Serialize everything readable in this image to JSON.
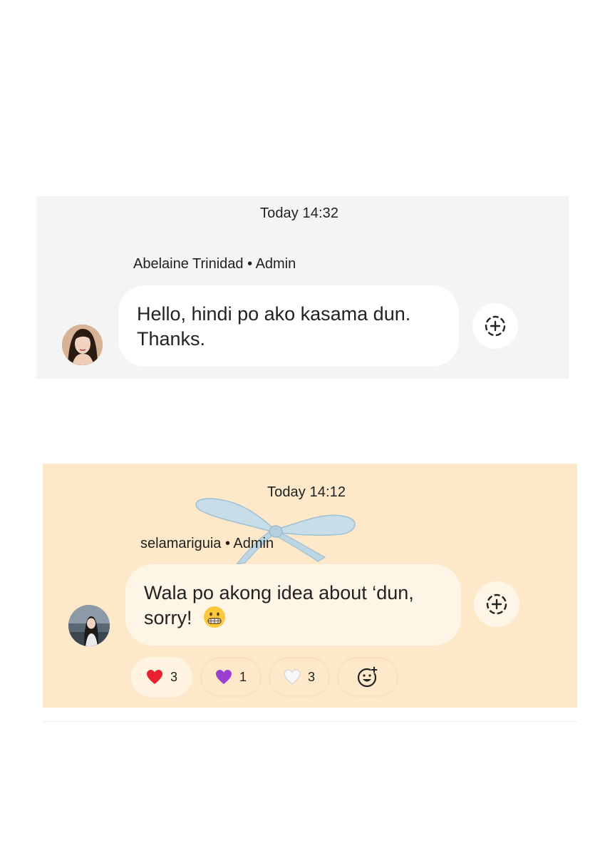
{
  "messages": [
    {
      "timestamp": "Today 14:32",
      "sender": "Abelaine Trinidad • Admin",
      "text_lines": [
        "Hello, hindi po ako kasama dun.",
        "Thanks."
      ],
      "avatar_icon": "woman-portrait-avatar",
      "add_reaction_icon": "add-reaction-icon",
      "panel_color": "#f4f4f4",
      "bubble_color": "#ffffff"
    },
    {
      "timestamp": "Today 14:12",
      "sender": "selamariguia • Admin",
      "text_lines": [
        "Wala po akong idea about ‘dun,",
        "sorry!"
      ],
      "trailing_emoji": "grimacing-face",
      "avatar_icon": "woman-beach-avatar",
      "add_reaction_icon": "add-reaction-icon",
      "decoration": "blue-ribbon-bow",
      "panel_color": "#fde9c9",
      "bubble_color": "#fff5e6",
      "reactions": [
        {
          "emoji": "red-heart",
          "count": "3",
          "active": true
        },
        {
          "emoji": "purple-heart",
          "count": "1",
          "active": false
        },
        {
          "emoji": "white-heart",
          "count": "3",
          "active": false
        },
        {
          "emoji": "add-emoji-reaction",
          "count": "",
          "active": false
        }
      ]
    }
  ]
}
